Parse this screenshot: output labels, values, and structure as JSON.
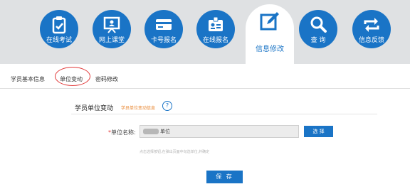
{
  "nav": {
    "items": [
      {
        "label": "在线考试",
        "icon": "exam-clipboard-icon"
      },
      {
        "label": "网上课堂",
        "icon": "classroom-board-icon"
      },
      {
        "label": "卡号报名",
        "icon": "card-icon"
      },
      {
        "label": "在线报名",
        "icon": "id-badge-icon"
      },
      {
        "label": "信息修改",
        "icon": "edit-icon",
        "active": true
      },
      {
        "label": "查 询",
        "icon": "search-icon"
      },
      {
        "label": "信息反馈",
        "icon": "feedback-arrows-icon"
      }
    ]
  },
  "subtabs": [
    "学员基本信息",
    "单位变动",
    "密码修改"
  ],
  "section": {
    "title": "学员单位变动",
    "hint": "学员单位变动信息",
    "help": "?"
  },
  "form": {
    "required_mark": "*",
    "label": "单位名称:",
    "value": "单位",
    "choose_label": "选 择",
    "hint": "点击选择按钮,在弹出页面中勾选单位,并确定"
  },
  "save_label": "保 存",
  "colors": {
    "accent": "#1a74c6",
    "nav_bg": "#dfe1e3",
    "hint_orange": "#e8832a",
    "annotation_red": "#e23a3a"
  }
}
